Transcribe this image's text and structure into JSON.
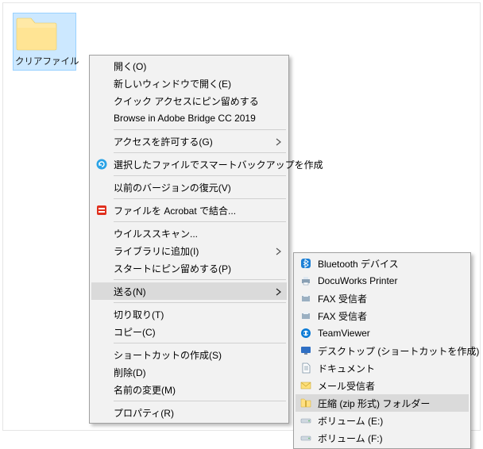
{
  "folder": {
    "label": "クリアファイル"
  },
  "menu1": {
    "open": "開く(O)",
    "open_new": "新しいウィンドウで開く(E)",
    "pin_quick": "クイック アクセスにピン留めする",
    "bridge": "Browse in Adobe Bridge CC 2019",
    "grant_access": "アクセスを許可する(G)",
    "smart_backup": "選択したファイルでスマートバックアップを作成",
    "restore_prev": "以前のバージョンの復元(V)",
    "acrobat": "ファイルを Acrobat で結合...",
    "virus_scan": "ウイルススキャン...",
    "add_library": "ライブラリに追加(I)",
    "pin_start": "スタートにピン留めする(P)",
    "send_to": "送る(N)",
    "cut": "切り取り(T)",
    "copy": "コピー(C)",
    "shortcut": "ショートカットの作成(S)",
    "delete": "削除(D)",
    "rename": "名前の変更(M)",
    "properties": "プロパティ(R)"
  },
  "menu2": {
    "bluetooth": "Bluetooth デバイス",
    "docuworks": "DocuWorks Printer",
    "fax_recipient": "FAX 受信者",
    "fax_recipient2": "FAX 受信者",
    "teamviewer": "TeamViewer",
    "desktop": "デスクトップ (ショートカットを作成)",
    "documents": "ドキュメント",
    "mail": "メール受信者",
    "compressed": "圧縮 (zip 形式) フォルダー",
    "vol_e": "ボリューム (E:)",
    "vol_f": "ボリューム (F:)"
  }
}
